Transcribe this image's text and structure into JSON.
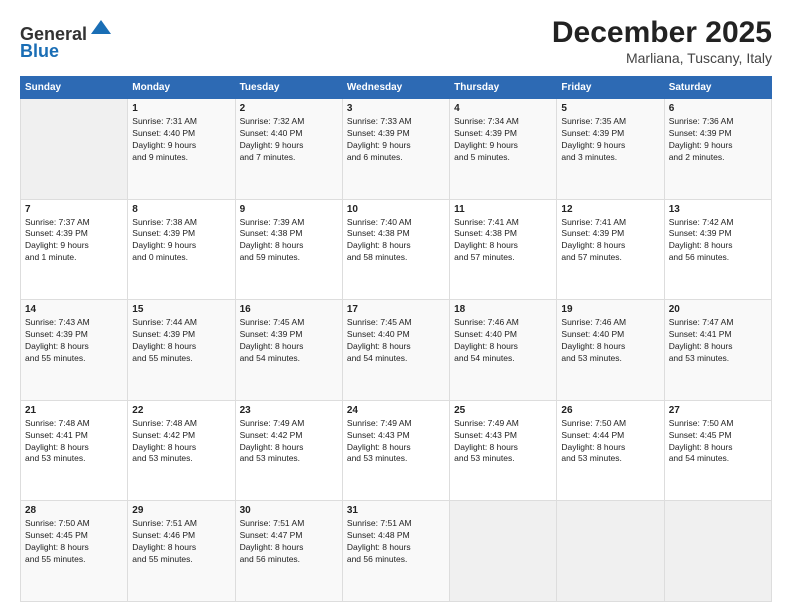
{
  "header": {
    "logo_line1": "General",
    "logo_line2": "Blue",
    "month_title": "December 2025",
    "location": "Marliana, Tuscany, Italy"
  },
  "days_of_week": [
    "Sunday",
    "Monday",
    "Tuesday",
    "Wednesday",
    "Thursday",
    "Friday",
    "Saturday"
  ],
  "weeks": [
    [
      {
        "day": "",
        "info": ""
      },
      {
        "day": "1",
        "info": "Sunrise: 7:31 AM\nSunset: 4:40 PM\nDaylight: 9 hours\nand 9 minutes."
      },
      {
        "day": "2",
        "info": "Sunrise: 7:32 AM\nSunset: 4:40 PM\nDaylight: 9 hours\nand 7 minutes."
      },
      {
        "day": "3",
        "info": "Sunrise: 7:33 AM\nSunset: 4:39 PM\nDaylight: 9 hours\nand 6 minutes."
      },
      {
        "day": "4",
        "info": "Sunrise: 7:34 AM\nSunset: 4:39 PM\nDaylight: 9 hours\nand 5 minutes."
      },
      {
        "day": "5",
        "info": "Sunrise: 7:35 AM\nSunset: 4:39 PM\nDaylight: 9 hours\nand 3 minutes."
      },
      {
        "day": "6",
        "info": "Sunrise: 7:36 AM\nSunset: 4:39 PM\nDaylight: 9 hours\nand 2 minutes."
      }
    ],
    [
      {
        "day": "7",
        "info": "Sunrise: 7:37 AM\nSunset: 4:39 PM\nDaylight: 9 hours\nand 1 minute."
      },
      {
        "day": "8",
        "info": "Sunrise: 7:38 AM\nSunset: 4:39 PM\nDaylight: 9 hours\nand 0 minutes."
      },
      {
        "day": "9",
        "info": "Sunrise: 7:39 AM\nSunset: 4:38 PM\nDaylight: 8 hours\nand 59 minutes."
      },
      {
        "day": "10",
        "info": "Sunrise: 7:40 AM\nSunset: 4:38 PM\nDaylight: 8 hours\nand 58 minutes."
      },
      {
        "day": "11",
        "info": "Sunrise: 7:41 AM\nSunset: 4:38 PM\nDaylight: 8 hours\nand 57 minutes."
      },
      {
        "day": "12",
        "info": "Sunrise: 7:41 AM\nSunset: 4:39 PM\nDaylight: 8 hours\nand 57 minutes."
      },
      {
        "day": "13",
        "info": "Sunrise: 7:42 AM\nSunset: 4:39 PM\nDaylight: 8 hours\nand 56 minutes."
      }
    ],
    [
      {
        "day": "14",
        "info": "Sunrise: 7:43 AM\nSunset: 4:39 PM\nDaylight: 8 hours\nand 55 minutes."
      },
      {
        "day": "15",
        "info": "Sunrise: 7:44 AM\nSunset: 4:39 PM\nDaylight: 8 hours\nand 55 minutes."
      },
      {
        "day": "16",
        "info": "Sunrise: 7:45 AM\nSunset: 4:39 PM\nDaylight: 8 hours\nand 54 minutes."
      },
      {
        "day": "17",
        "info": "Sunrise: 7:45 AM\nSunset: 4:40 PM\nDaylight: 8 hours\nand 54 minutes."
      },
      {
        "day": "18",
        "info": "Sunrise: 7:46 AM\nSunset: 4:40 PM\nDaylight: 8 hours\nand 54 minutes."
      },
      {
        "day": "19",
        "info": "Sunrise: 7:46 AM\nSunset: 4:40 PM\nDaylight: 8 hours\nand 53 minutes."
      },
      {
        "day": "20",
        "info": "Sunrise: 7:47 AM\nSunset: 4:41 PM\nDaylight: 8 hours\nand 53 minutes."
      }
    ],
    [
      {
        "day": "21",
        "info": "Sunrise: 7:48 AM\nSunset: 4:41 PM\nDaylight: 8 hours\nand 53 minutes."
      },
      {
        "day": "22",
        "info": "Sunrise: 7:48 AM\nSunset: 4:42 PM\nDaylight: 8 hours\nand 53 minutes."
      },
      {
        "day": "23",
        "info": "Sunrise: 7:49 AM\nSunset: 4:42 PM\nDaylight: 8 hours\nand 53 minutes."
      },
      {
        "day": "24",
        "info": "Sunrise: 7:49 AM\nSunset: 4:43 PM\nDaylight: 8 hours\nand 53 minutes."
      },
      {
        "day": "25",
        "info": "Sunrise: 7:49 AM\nSunset: 4:43 PM\nDaylight: 8 hours\nand 53 minutes."
      },
      {
        "day": "26",
        "info": "Sunrise: 7:50 AM\nSunset: 4:44 PM\nDaylight: 8 hours\nand 53 minutes."
      },
      {
        "day": "27",
        "info": "Sunrise: 7:50 AM\nSunset: 4:45 PM\nDaylight: 8 hours\nand 54 minutes."
      }
    ],
    [
      {
        "day": "28",
        "info": "Sunrise: 7:50 AM\nSunset: 4:45 PM\nDaylight: 8 hours\nand 55 minutes."
      },
      {
        "day": "29",
        "info": "Sunrise: 7:51 AM\nSunset: 4:46 PM\nDaylight: 8 hours\nand 55 minutes."
      },
      {
        "day": "30",
        "info": "Sunrise: 7:51 AM\nSunset: 4:47 PM\nDaylight: 8 hours\nand 56 minutes."
      },
      {
        "day": "31",
        "info": "Sunrise: 7:51 AM\nSunset: 4:48 PM\nDaylight: 8 hours\nand 56 minutes."
      },
      {
        "day": "",
        "info": ""
      },
      {
        "day": "",
        "info": ""
      },
      {
        "day": "",
        "info": ""
      }
    ]
  ]
}
